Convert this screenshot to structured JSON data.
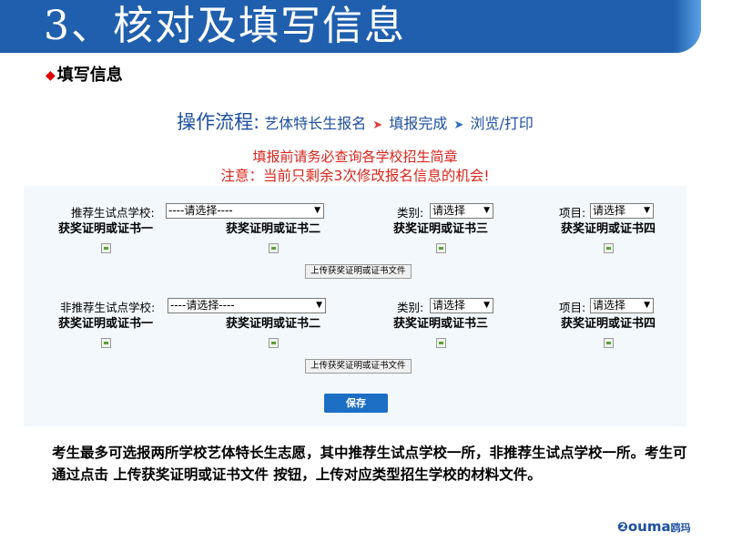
{
  "slide": {
    "title": "3、核对及填写信息",
    "subheading": "填写信息",
    "diamond_icon": "◆",
    "colors": {
      "banner": "#1f5fae",
      "notice": "#d9251c",
      "accent": "#1d4fa3",
      "save_button": "#1d6fc6"
    }
  },
  "flow": {
    "title": "操作流程:",
    "steps": [
      "艺体特长生报名",
      "填报完成",
      "浏览/打印"
    ],
    "arrow_red": "➤",
    "arrow_blue": "➤"
  },
  "notices": [
    "填报前请务必查询各学校招生简章",
    "注意：当前只剩余3次修改报名信息的机会!"
  ],
  "sections": [
    {
      "school_label": "推荐生试点学校:",
      "school_value": "----请选择----",
      "category_label": "类别:",
      "category_value": "请选择",
      "item_label": "项目:",
      "item_value": "请选择",
      "certs": [
        "获奖证明或证书一",
        "获奖证明或证书二",
        "获奖证明或证书三",
        "获奖证明或证书四"
      ],
      "upload_label": "上传获奖证明或证书文件"
    },
    {
      "school_label": "非推荐生试点学校:",
      "school_value": "----请选择----",
      "category_label": "类别:",
      "category_value": "请选择",
      "item_label": "项目:",
      "item_value": "请选择",
      "certs": [
        "获奖证明或证书一",
        "获奖证明或证书二",
        "获奖证明或证书三",
        "获奖证明或证书四"
      ],
      "upload_label": "上传获奖证明或证书文件"
    }
  ],
  "save_label": "保存",
  "description": "考生最多可选报两所学校艺体特长生志愿，其中推荐生试点学校一所，非推荐生试点学校一所。考生可通过点击 上传获奖证明或证书文件 按钮，上传对应类型招生学校的材料文件。",
  "logo": {
    "ring": "❷",
    "word": "ouma",
    "cn": "鸥玛"
  }
}
